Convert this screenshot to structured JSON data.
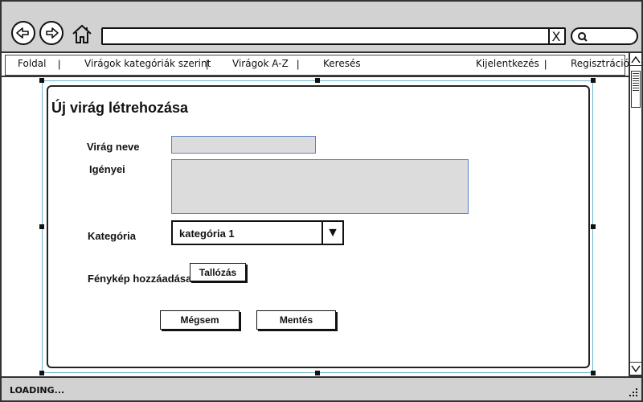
{
  "browser": {
    "back_icon": "arrow-left-circle-icon",
    "forward_icon": "arrow-right-circle-icon",
    "home_icon": "home-icon",
    "url_value": "",
    "url_clear_label": "X",
    "search_icon": "search-icon"
  },
  "nav": {
    "items": [
      {
        "label": "Foldal"
      },
      {
        "label": "Virágok kategóriák szerint"
      },
      {
        "label": "Virágok A-Z"
      },
      {
        "label": "Keresés"
      },
      {
        "label": "Kijelentkezés"
      },
      {
        "label": "Regisztráció"
      }
    ],
    "separator": "|"
  },
  "form": {
    "title": "Új virág létrehozása",
    "name_label": "Virág neve",
    "name_value": "",
    "needs_label": "Igényei",
    "needs_value": "",
    "category_label": "Kategória",
    "category_selected": "kategória 1",
    "category_arrow": "▼",
    "photo_label": "Fénykép hozzáadása",
    "browse_button": "Tallózás",
    "cancel_button": "Mégsem",
    "save_button": "Mentés"
  },
  "status": {
    "text": "LOADING..."
  }
}
